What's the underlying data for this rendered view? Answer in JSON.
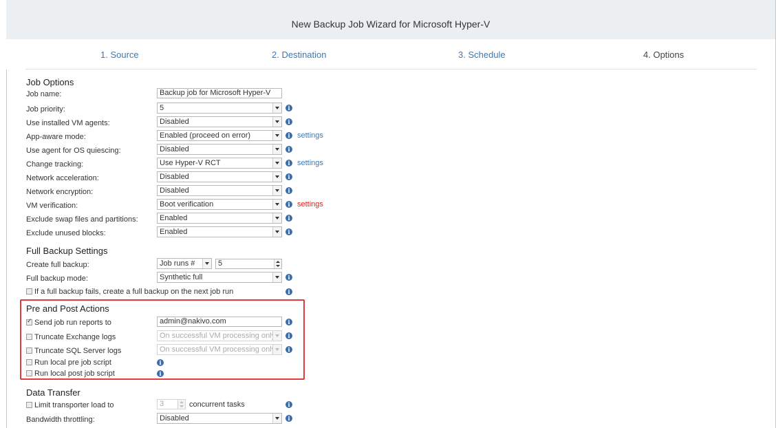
{
  "window": {
    "title": "New Backup Job Wizard for Microsoft Hyper-V"
  },
  "steps": [
    "1. Source",
    "2. Destination",
    "3. Schedule",
    "4. Options"
  ],
  "job_options": {
    "heading": "Job Options",
    "job_name_label": "Job name:",
    "job_name_value": "Backup job for Microsoft Hyper-V",
    "rows": [
      {
        "label": "Job priority:",
        "value": "5"
      },
      {
        "label": "Use installed VM agents:",
        "value": "Disabled"
      },
      {
        "label": "App-aware mode:",
        "value": "Enabled (proceed on error)",
        "link": "settings"
      },
      {
        "label": "Use agent for OS quiescing:",
        "value": "Disabled"
      },
      {
        "label": "Change tracking:",
        "value": "Use Hyper-V RCT",
        "link": "settings"
      },
      {
        "label": "Network acceleration:",
        "value": "Disabled"
      },
      {
        "label": "Network encryption:",
        "value": "Disabled"
      },
      {
        "label": "VM verification:",
        "value": "Boot verification",
        "link": "settings"
      },
      {
        "label": "Exclude swap files and partitions:",
        "value": "Enabled"
      },
      {
        "label": "Exclude unused blocks:",
        "value": "Enabled"
      }
    ]
  },
  "full_backup": {
    "heading": "Full Backup Settings",
    "create_label": "Create full backup:",
    "create_mode": "Job runs #",
    "create_count": "5",
    "mode_label": "Full backup mode:",
    "mode_value": "Synthetic full",
    "fallback_label": "If a full backup fails, create a full backup on the next job run"
  },
  "pre_post": {
    "heading": "Pre and Post Actions",
    "send_reports_label": "Send job run reports to",
    "send_reports_value": "admin@nakivo.com",
    "truncate_exchange_label": "Truncate Exchange logs",
    "truncate_exchange_value": "On successful VM processing only",
    "truncate_sql_label": "Truncate SQL Server logs",
    "truncate_sql_value": "On successful VM processing only",
    "pre_script_label": "Run local pre job script",
    "post_script_label": "Run local post job script"
  },
  "data_transfer": {
    "heading": "Data Transfer",
    "limit_label": "Limit transporter load to",
    "limit_value": "3",
    "limit_suffix": "concurrent tasks",
    "bandwidth_label": "Bandwidth throttling:",
    "bandwidth_value": "Disabled"
  },
  "colors": {
    "accent": "#3a79b8",
    "highlight": "#e03c3c",
    "warning_link": "#e02020"
  },
  "icons": {
    "info": "info-icon",
    "dropdown": "chevron-down-icon",
    "spinner": "spinner-icon"
  }
}
